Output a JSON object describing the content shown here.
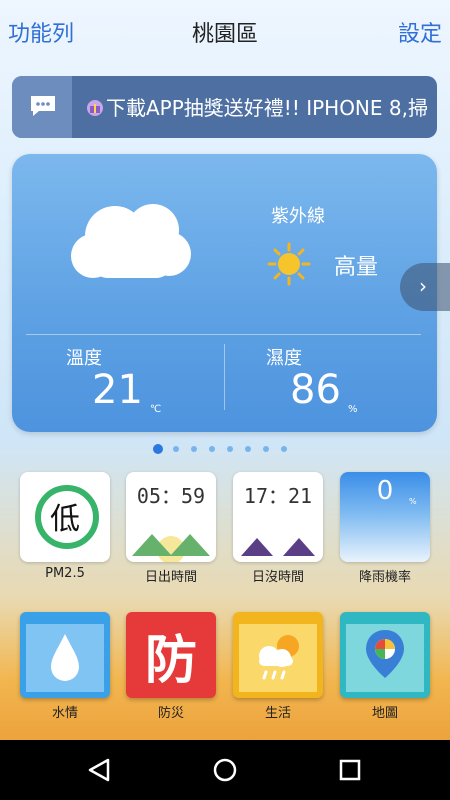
{
  "header": {
    "menu_label": "功能列",
    "title": "桃園區",
    "settings_label": "設定"
  },
  "marquee": {
    "text": "下載APP抽獎送好禮!! IPHONE 8,掃"
  },
  "weather": {
    "uv_label": "紫外線",
    "uv_value": "高量",
    "temp_label": "溫度",
    "temp_value": "21",
    "temp_unit": "℃",
    "humidity_label": "濕度",
    "humidity_value": "86",
    "humidity_unit": "%",
    "condition_icon": "cloud-icon"
  },
  "pager": {
    "count": 8,
    "active": 0
  },
  "tiles": [
    {
      "label": "PM2.5",
      "value": "低",
      "color": "#37b46a"
    },
    {
      "label": "日出時間",
      "value": "05：59"
    },
    {
      "label": "日沒時間",
      "value": "17：21"
    },
    {
      "label": "降雨機率",
      "value": "0",
      "unit": "%"
    }
  ],
  "buttons": [
    {
      "label": "水情",
      "icon": "water-drop-icon",
      "color": "#3aa0e8"
    },
    {
      "label": "防災",
      "glyph": "防",
      "color": "#e63a3a"
    },
    {
      "label": "生活",
      "icon": "cloud-sun-rain-icon",
      "color": "#f2b51e"
    },
    {
      "label": "地圖",
      "icon": "map-pin-icon",
      "color": "#2fb7c2"
    }
  ],
  "colors": {
    "accent": "#2f6fd6",
    "card": "#5fa2e4",
    "banner": "#4d6fa2"
  }
}
